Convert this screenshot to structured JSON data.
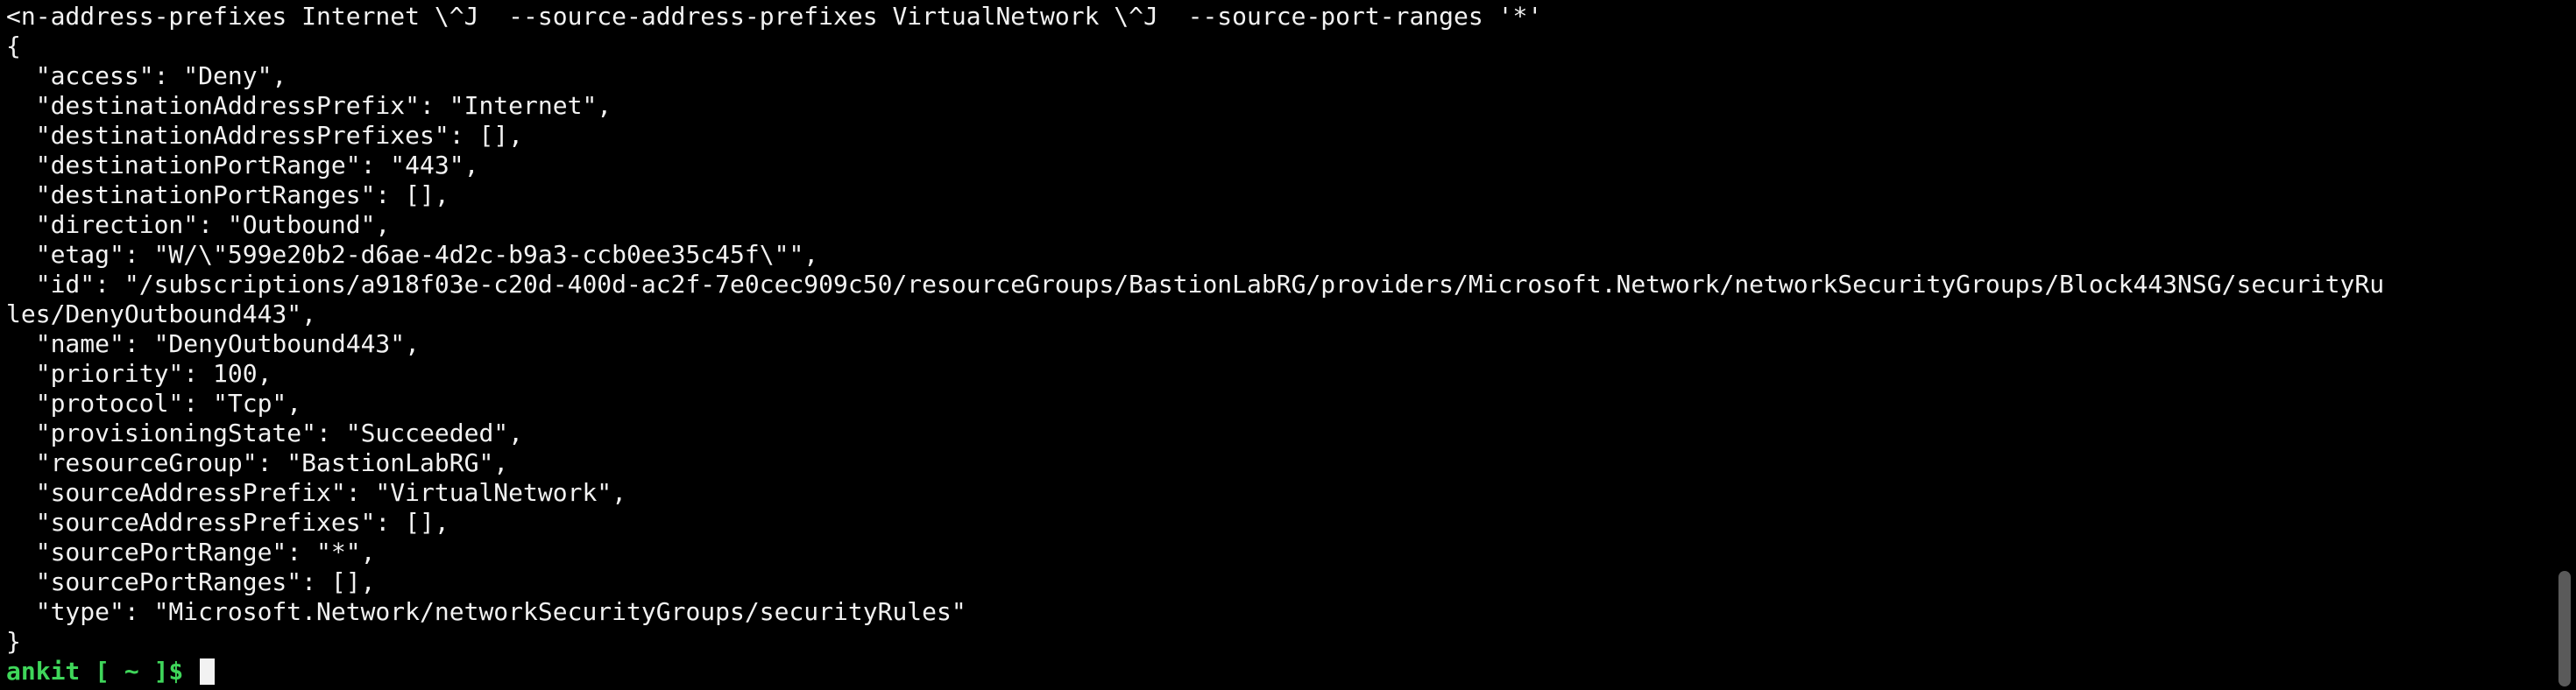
{
  "terminal": {
    "lines": [
      "<n-address-prefixes Internet \\^J  --source-address-prefixes VirtualNetwork \\^J  --source-port-ranges '*'",
      "{",
      "  \"access\": \"Deny\",",
      "  \"destinationAddressPrefix\": \"Internet\",",
      "  \"destinationAddressPrefixes\": [],",
      "  \"destinationPortRange\": \"443\",",
      "  \"destinationPortRanges\": [],",
      "  \"direction\": \"Outbound\",",
      "  \"etag\": \"W/\\\"599e20b2-d6ae-4d2c-b9a3-ccb0ee35c45f\\\"\",",
      "  \"id\": \"/subscriptions/a918f03e-c20d-400d-ac2f-7e0cec909c50/resourceGroups/BastionLabRG/providers/Microsoft.Network/networkSecurityGroups/Block443NSG/securityRu",
      "les/DenyOutbound443\",",
      "  \"name\": \"DenyOutbound443\",",
      "  \"priority\": 100,",
      "  \"protocol\": \"Tcp\",",
      "  \"provisioningState\": \"Succeeded\",",
      "  \"resourceGroup\": \"BastionLabRG\",",
      "  \"sourceAddressPrefix\": \"VirtualNetwork\",",
      "  \"sourceAddressPrefixes\": [],",
      "  \"sourcePortRange\": \"*\",",
      "  \"sourcePortRanges\": [],",
      "  \"type\": \"Microsoft.Network/networkSecurityGroups/securityRules\"",
      "}"
    ],
    "prompt": "ankit [ ~ ]$ ",
    "colors": {
      "background": "#000000",
      "foreground": "#f2f2f2",
      "prompt": "#3fd65a"
    }
  }
}
